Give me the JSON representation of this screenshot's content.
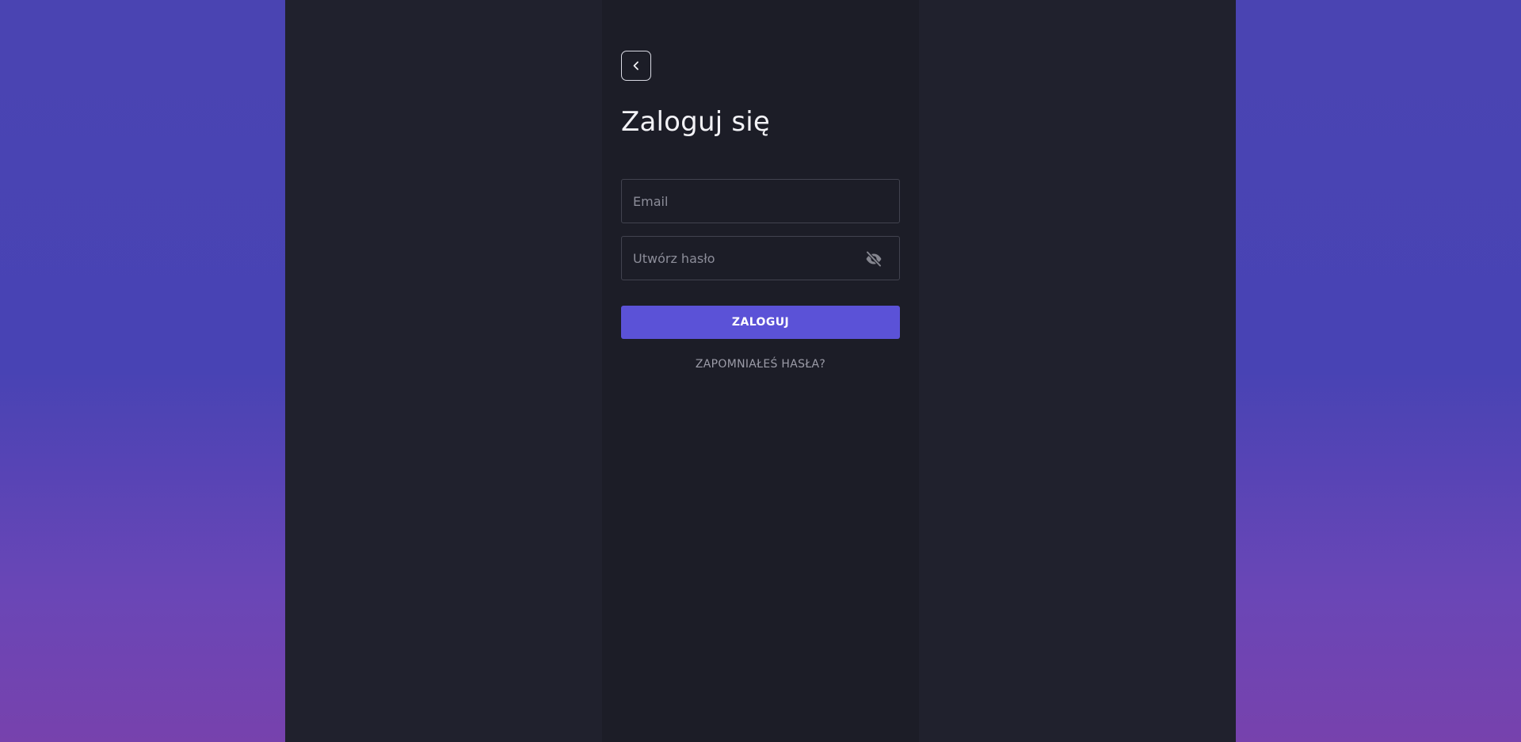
{
  "page": {
    "title": "Zaloguj się"
  },
  "form": {
    "email_placeholder": "Email",
    "email_value": "",
    "password_placeholder": "Utwórz hasło",
    "password_value": "",
    "submit_label": "ZALOGUJ",
    "forgot_label": "ZAPOMNIAŁEŚ HASŁA?"
  },
  "icons": {
    "back": "chevron-left-icon",
    "password_visibility": "eye-off-icon"
  },
  "colors": {
    "accent": "#5b52d7",
    "background_gradient_top": "#4a44b2",
    "background_gradient_bottom": "#7742ad",
    "panel": "#20212d",
    "inner_panel": "#1c1d27"
  }
}
